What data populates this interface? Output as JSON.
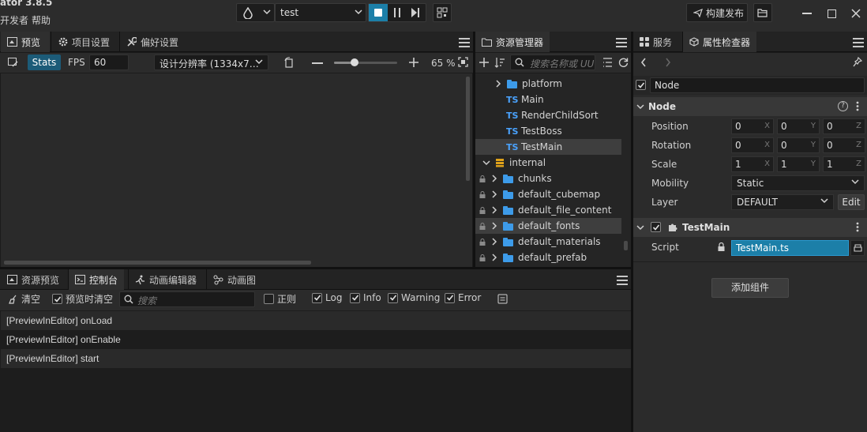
{
  "app": {
    "title": "ator 3.8.5",
    "menu": [
      "开发者",
      "帮助"
    ],
    "scene_name": "test",
    "build_label": "构建发布"
  },
  "preview": {
    "tabs": [
      "预览",
      "项目设置",
      "偏好设置"
    ],
    "stats_label": "Stats",
    "fps_label": "FPS",
    "fps_value": "60",
    "resolution": "设计分辨率 (1334x7…",
    "zoom": "65 %",
    "zoom_fraction": 0.33
  },
  "assets": {
    "tab": "资源管理器",
    "search_placeholder": "搜索名称或 UU",
    "items": [
      {
        "name": "platform",
        "kind": "folder"
      },
      {
        "name": "Main",
        "kind": "ts"
      },
      {
        "name": "RenderChildSort",
        "kind": "ts"
      },
      {
        "name": "TestBoss",
        "kind": "ts"
      },
      {
        "name": "TestMain",
        "kind": "ts"
      },
      {
        "name": "internal",
        "kind": "db"
      },
      {
        "name": "chunks",
        "kind": "folder"
      },
      {
        "name": "default_cubemap",
        "kind": "folder"
      },
      {
        "name": "default_file_content",
        "kind": "folder"
      },
      {
        "name": "default_fonts",
        "kind": "folder"
      },
      {
        "name": "default_materials",
        "kind": "folder"
      },
      {
        "name": "default_prefab",
        "kind": "folder"
      }
    ],
    "ts_badge": "TS"
  },
  "inspector": {
    "tabs": [
      "服务",
      "属性检查器"
    ],
    "node_name": "Node",
    "section_node": "Node",
    "labels": {
      "position": "Position",
      "rotation": "Rotation",
      "scale": "Scale",
      "mobility": "Mobility",
      "layer": "Layer",
      "script": "Script"
    },
    "position": [
      "0",
      "0",
      "0"
    ],
    "rotation": [
      "0",
      "0",
      "0"
    ],
    "scale": [
      "1",
      "1",
      "1"
    ],
    "axes": [
      "X",
      "Y",
      "Z"
    ],
    "mobility": "Static",
    "layer": "DEFAULT",
    "edit_label": "Edit",
    "component": "TestMain",
    "script_value": "TestMain.ts",
    "add_component": "添加组件"
  },
  "console": {
    "tabs": [
      "资源预览",
      "控制台",
      "动画编辑器",
      "动画图"
    ],
    "clear_label": "清空",
    "clear_on_preview": "预览时清空",
    "search_placeholder": "搜索",
    "regex_label": "正则",
    "filters": [
      "Log",
      "Info",
      "Warning",
      "Error"
    ],
    "rows": [
      "[PreviewInEditor] onLoad",
      "[PreviewInEditor] onEnable",
      "[PreviewInEditor] start"
    ]
  },
  "colors": {
    "accent": "#1c7fa8",
    "folder": "#3d9be9",
    "ts": "#4aa3ff"
  }
}
